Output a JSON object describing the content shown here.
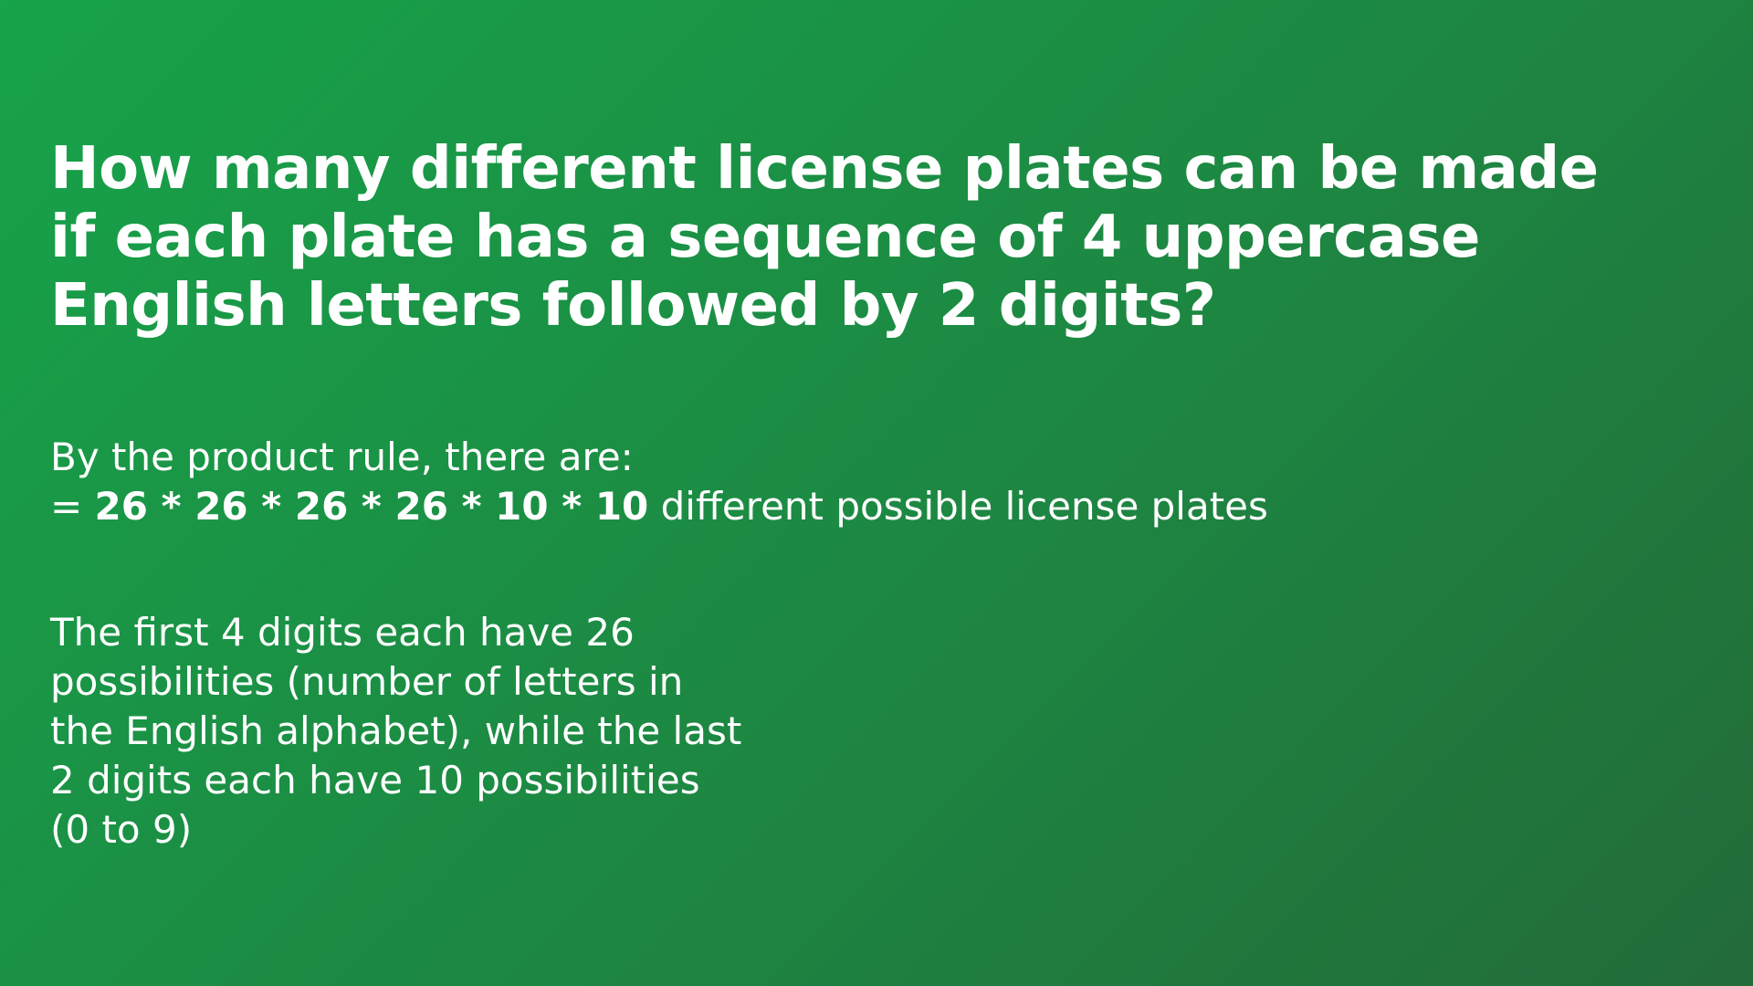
{
  "slide": {
    "question": "How many different license plates can be made if each plate has a sequence of 4 uppercase English letters followed by 2 digits?",
    "answer": {
      "intro": "By the product rule, there are:",
      "equals": "= ",
      "expression": "26 * 26 * 26 * 26 * 10 * 10",
      "suffix": " different possible license plates"
    },
    "explanation": "The first 4 digits each have 26 possibilities (number of letters in the English alphabet), while the last 2 digits each have 10 possibilities (0 to 9)"
  },
  "colors": {
    "background_start": "#17a34a",
    "background_end": "#236b39",
    "text": "#ffffff"
  }
}
